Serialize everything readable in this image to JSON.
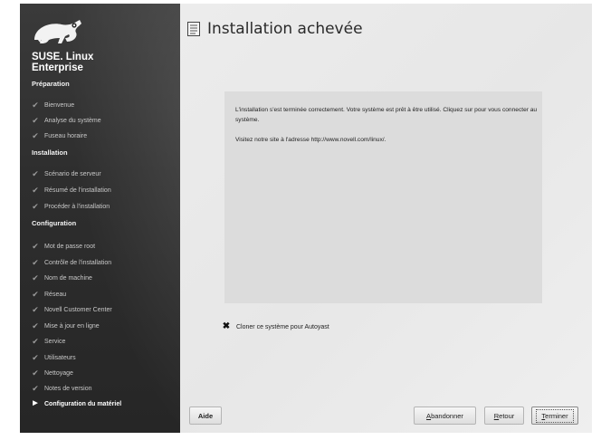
{
  "sidebar": {
    "brand": "SUSE. Linux\nEnterprise",
    "sections": {
      "preparation": "Préparation",
      "installation": "Installation",
      "configuration": "Configuration"
    },
    "preparation_steps": [
      "Bienvenue",
      "Analyse du système",
      "Fuseau horaire"
    ],
    "installation_steps": [
      "Scénario de serveur",
      "Résumé de l'installation",
      "Procéder à l'installation"
    ],
    "configuration_steps": [
      "Mot de passe root",
      "Contrôle de l'installation",
      "Nom de machine",
      "Réseau",
      "Novell Customer Center",
      "Mise à jour en ligne",
      "Service",
      "Utilisateurs",
      "Nettoyage",
      "Notes de version",
      "Configuration du matériel"
    ],
    "current_step": "Configuration du matériel"
  },
  "main": {
    "title": "Installation achevée",
    "message_line1": "L'installation s'est terminée correctement. Votre système est prêt à être utilisé. Cliquez sur pour vous connecter au système.",
    "message_line2": "Visitez notre site à l'adresse http://www.novell.com/linux/.",
    "clone_label": "Cloner ce système pour Autoyast",
    "clone_checked": true
  },
  "buttons": {
    "help": "Aide",
    "abort_mnemonic": "A",
    "abort_rest": "bandonner",
    "back_mnemonic": "R",
    "back_rest": "etour",
    "finish_mnemonic": "T",
    "finish_rest": "erminer"
  },
  "colors": {
    "sidebar_bg": "#2e2e2e",
    "main_bg": "#e9e9e9",
    "content_box": "#dcdcdc"
  }
}
